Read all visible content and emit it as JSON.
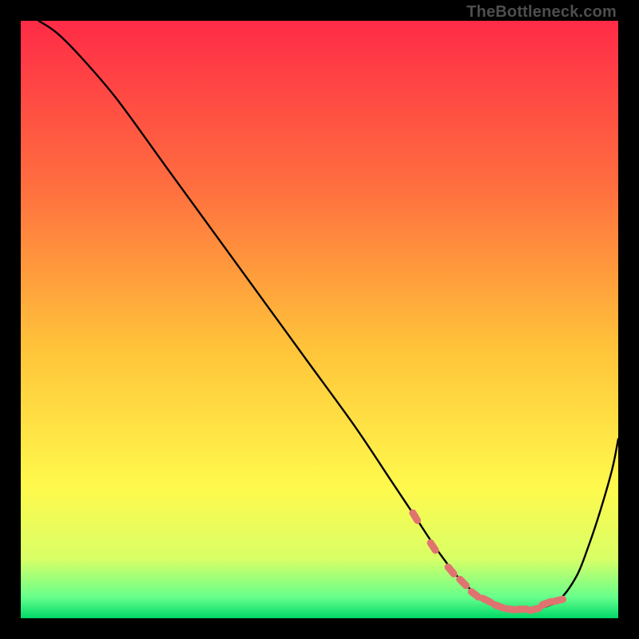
{
  "watermark": "TheBottleneck.com",
  "colors": {
    "background": "#000000",
    "gradient_top": "#ff2b47",
    "gradient_mid_upper": "#ff7a3d",
    "gradient_mid": "#ffd23a",
    "gradient_mid_lower": "#fff94c",
    "gradient_low": "#d9ff66",
    "gradient_bottom": "#00e06a",
    "curve": "#000000",
    "marker": "#e0736f"
  },
  "chart_data": {
    "type": "line",
    "title": "",
    "xlabel": "",
    "ylabel": "",
    "xlim": [
      0,
      100
    ],
    "ylim": [
      0,
      100
    ],
    "series": [
      {
        "name": "bottleneck-curve",
        "x": [
          3,
          6,
          10,
          16,
          24,
          32,
          40,
          48,
          56,
          62,
          66,
          70,
          74,
          78,
          82,
          86,
          90,
          93,
          95,
          97,
          99,
          100
        ],
        "y": [
          100,
          98,
          94,
          87,
          76,
          65,
          54,
          43,
          32,
          23,
          17,
          11,
          6,
          3,
          1.5,
          1.5,
          3,
          7,
          12,
          18,
          25,
          30
        ]
      }
    ],
    "markers": {
      "name": "highlighted-range",
      "x": [
        66,
        69,
        72,
        74,
        76,
        78,
        80,
        82,
        84,
        86,
        88,
        90
      ],
      "y": [
        17,
        12,
        8,
        6,
        4,
        3,
        2,
        1.5,
        1.5,
        1.5,
        2.5,
        3
      ]
    },
    "gradient_stops": [
      {
        "pos": 0.0,
        "color": "#ff2b47"
      },
      {
        "pos": 0.28,
        "color": "#ff6f3f"
      },
      {
        "pos": 0.55,
        "color": "#ffc43a"
      },
      {
        "pos": 0.78,
        "color": "#fff94c"
      },
      {
        "pos": 0.9,
        "color": "#d9ff66"
      },
      {
        "pos": 0.965,
        "color": "#66ff8c"
      },
      {
        "pos": 1.0,
        "color": "#00d868"
      }
    ]
  }
}
